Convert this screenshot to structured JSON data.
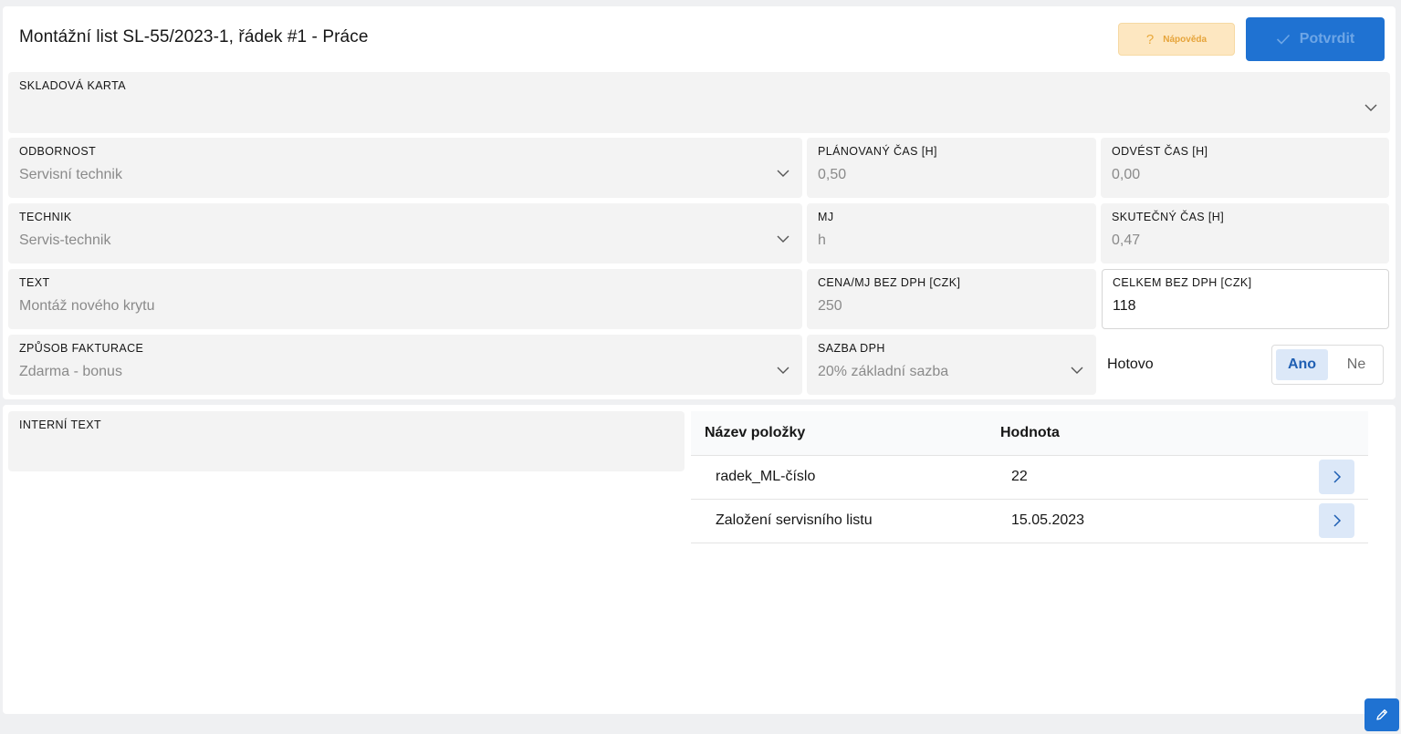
{
  "header": {
    "title": "Montážní list SL-55/2023-1, řádek #1 - Práce",
    "help_label": "Nápověda",
    "confirm_label": "Potvrdit"
  },
  "fields": {
    "skladova_karta": {
      "label": "SKLADOVÁ KARTA",
      "value": ""
    },
    "odbornost": {
      "label": "ODBORNOST",
      "value": "Servisní technik"
    },
    "planovany_cas": {
      "label": "PLÁNOVANÝ ČAS [H]",
      "value": "0,50"
    },
    "odvest_cas": {
      "label": "ODVÉST ČAS [H]",
      "value": "0,00"
    },
    "technik": {
      "label": "TECHNIK",
      "value": "Servis-technik"
    },
    "mj": {
      "label": "MJ",
      "value": "h"
    },
    "skutecny_cas": {
      "label": "SKUTEČNÝ ČAS [H]",
      "value": "0,47"
    },
    "text": {
      "label": "TEXT",
      "value": "Montáž nového krytu"
    },
    "cena_mj": {
      "label": "CENA/MJ BEZ DPH [CZK]",
      "value": "250"
    },
    "celkem": {
      "label": "CELKEM BEZ DPH [CZK]",
      "value": "118"
    },
    "zpusob_fakturace": {
      "label": "ZPŮSOB FAKTURACE",
      "value": "Zdarma - bonus"
    },
    "sazba_dph": {
      "label": "SAZBA DPH",
      "value": "20% základní sazba"
    },
    "interni_text": {
      "label": "INTERNÍ TEXT",
      "value": ""
    }
  },
  "hotovo": {
    "label": "Hotovo",
    "yes": "Ano",
    "no": "Ne",
    "selected": "Ano"
  },
  "table": {
    "headers": [
      "Název položky",
      "Hodnota"
    ],
    "rows": [
      {
        "name": "radek_ML-číslo",
        "value": "22"
      },
      {
        "name": "Založení servisního listu",
        "value": "15.05.2023"
      }
    ]
  },
  "colors": {
    "primary": "#1f72d2",
    "help_bg": "#fde7c1",
    "field_bg": "#f3f3f3",
    "selected_toggle_bg": "#dce8f8"
  },
  "icons": {
    "help": "question-icon",
    "confirm": "check-icon",
    "dropdown": "chevron-down-icon",
    "row_action": "chevron-right-icon",
    "edit": "pencil-icon"
  }
}
